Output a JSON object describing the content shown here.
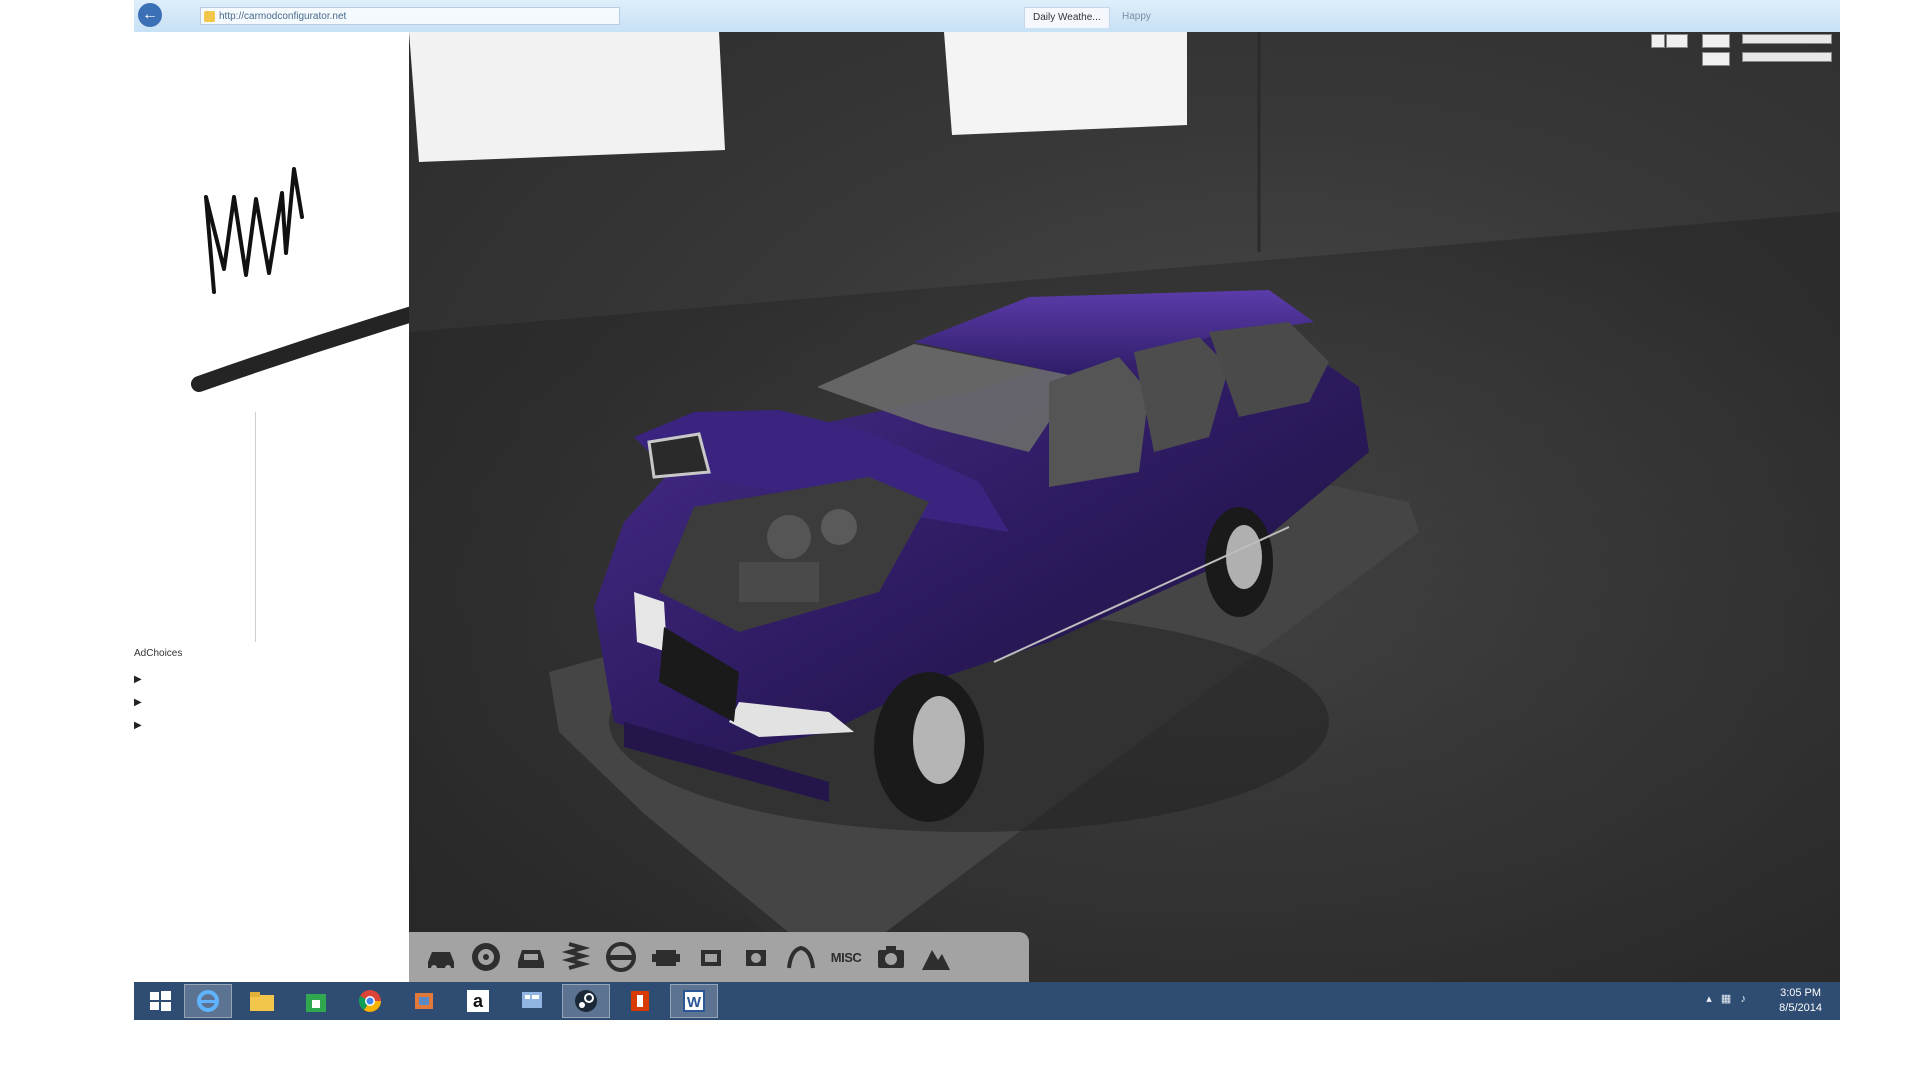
{
  "browser": {
    "address": "http://carmodconfigurator.net",
    "tabs": [
      "Daily Weathe...",
      "Happy"
    ]
  },
  "sidebar_ad": {
    "adchoices_label": "AdChoices",
    "links": [
      "",
      "",
      ""
    ]
  },
  "toolbar": {
    "buttons": [
      {
        "icon": "car-body-icon"
      },
      {
        "icon": "wheel-icon"
      },
      {
        "icon": "paint-icon"
      },
      {
        "icon": "suspension-icon"
      },
      {
        "icon": "steering-wheel-icon"
      },
      {
        "icon": "engine-icon"
      },
      {
        "icon": "engine-upgrade-icon"
      },
      {
        "icon": "engine-tune-icon"
      },
      {
        "icon": "exhaust-icon"
      },
      {
        "icon": "misc-icon",
        "label": "MISC"
      },
      {
        "icon": "camera-icon"
      },
      {
        "icon": "environment-icon"
      }
    ]
  },
  "taskbar": {
    "apps": [
      {
        "icon": "start-windows-icon"
      },
      {
        "icon": "internet-explorer-icon",
        "active": true
      },
      {
        "icon": "file-explorer-icon"
      },
      {
        "icon": "store-icon"
      },
      {
        "icon": "chrome-icon"
      },
      {
        "icon": "media-app-icon"
      },
      {
        "icon": "amazon-icon"
      },
      {
        "icon": "control-panel-icon"
      },
      {
        "icon": "steam-icon",
        "active": true
      },
      {
        "icon": "office-icon"
      },
      {
        "icon": "word-icon",
        "active": true
      }
    ],
    "time": "3:05 PM",
    "date": "8/5/2014"
  },
  "colors": {
    "car_body": "#2c1a5e",
    "taskbar": "#2f4d72",
    "viewport_bg": "#3a3a3a",
    "toolbar_bg": "#a3a3a3"
  }
}
